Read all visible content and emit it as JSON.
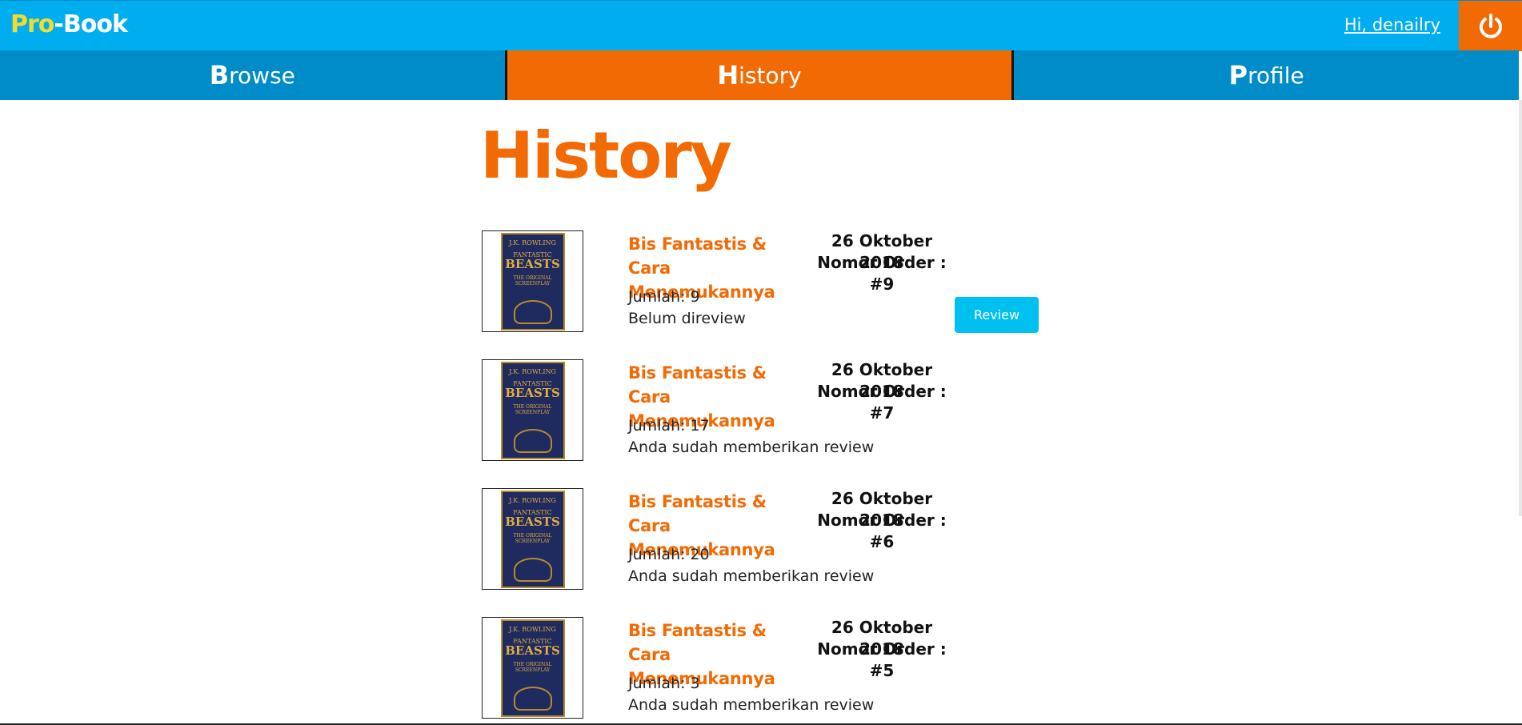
{
  "header": {
    "logo_part1": "Pro",
    "logo_part2": "-Book",
    "greeting": "Hi, denailry",
    "logout_icon": "power-icon",
    "colors": {
      "header_bg": "#00adee",
      "accent": "#f26a04",
      "logo_pro": "#f4dc2c",
      "tab_bg": "#008cc8"
    }
  },
  "tabs": [
    {
      "cap": "B",
      "rest": "rowse",
      "active": false
    },
    {
      "cap": "H",
      "rest": "istory",
      "active": true
    },
    {
      "cap": "P",
      "rest": "rofile",
      "active": false
    }
  ],
  "page": {
    "title": "History"
  },
  "orders": [
    {
      "book_title": "Bis Fantastis & Cara Menemukannya",
      "quantity": "Jumlah: 9",
      "status": "Belum direview",
      "date": "26 Oktober 2018",
      "order_no": "Nomor Order : #9",
      "review_label": "Review",
      "cover": {
        "author": "J.K. ROWLING",
        "line1": "FANTASTIC",
        "line2": "BEASTS",
        "line3": "THE ORIGINAL SCREENPLAY"
      }
    },
    {
      "book_title": "Bis Fantastis & Cara Menemukannya",
      "quantity": "Jumlah: 17",
      "status": "Anda sudah memberikan review",
      "date": "26 Oktober 2018",
      "order_no": "Nomor Order : #7",
      "cover": {
        "author": "J.K. ROWLING",
        "line1": "FANTASTIC",
        "line2": "BEASTS",
        "line3": "THE ORIGINAL SCREENPLAY"
      }
    },
    {
      "book_title": "Bis Fantastis & Cara Menemukannya",
      "quantity": "Jumlah: 20",
      "status": "Anda sudah memberikan review",
      "date": "26 Oktober 2018",
      "order_no": "Nomor Order : #6",
      "cover": {
        "author": "J.K. ROWLING",
        "line1": "FANTASTIC",
        "line2": "BEASTS",
        "line3": "THE ORIGINAL SCREENPLAY"
      }
    },
    {
      "book_title": "Bis Fantastis & Cara Menemukannya",
      "quantity": "Jumlah: 3",
      "status": "Anda sudah memberikan review",
      "date": "26 Oktober 2018",
      "order_no": "Nomor Order : #5",
      "cover": {
        "author": "J.K. ROWLING",
        "line1": "FANTASTIC",
        "line2": "BEASTS",
        "line3": "THE ORIGINAL SCREENPLAY"
      }
    }
  ]
}
